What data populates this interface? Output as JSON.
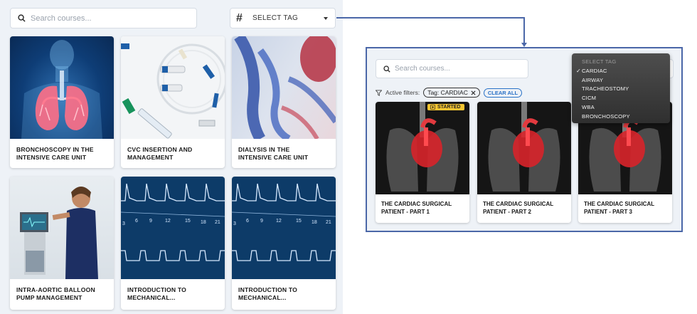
{
  "main": {
    "search": {
      "placeholder": "Search courses..."
    },
    "tag_select": {
      "label": "SELECT TAG"
    },
    "courses": [
      {
        "title_line1": "BRONCHOSCOPY IN THE",
        "title_line2": "INTENSIVE CARE UNIT"
      },
      {
        "title_line1": "CVC INSERTION AND",
        "title_line2": "MANAGEMENT"
      },
      {
        "title_line1": "DIALYSIS IN THE",
        "title_line2": "INTENSIVE CARE UNIT"
      },
      {
        "title_line1": "INTRA-AORTIC BALLOON",
        "title_line2": "PUMP MANAGEMENT"
      },
      {
        "title_line1": "INTRODUCTION TO",
        "title_line2": "MECHANICAL..."
      },
      {
        "title_line1": "INTRODUCTION TO",
        "title_line2": "MECHANICAL..."
      }
    ],
    "waveform_ticks": [
      "3",
      "6",
      "9",
      "12",
      "15",
      "18",
      "21"
    ]
  },
  "zoom": {
    "search": {
      "placeholder": "Search courses..."
    },
    "filters": {
      "label": "Active filters:",
      "tag_chip": "Tag: CARDIAC",
      "clear_all": "CLEAR ALL"
    },
    "courses": [
      {
        "title_line1": "THE CARDIAC SURGICAL",
        "title_line2": "PATIENT - PART 1",
        "badge": "STARTED"
      },
      {
        "title_line1": "THE CARDIAC SURGICAL",
        "title_line2": "PATIENT - PART 2"
      },
      {
        "title_line1": "THE CARDIAC SURGICAL",
        "title_line2": "PATIENT - PART 3"
      }
    ],
    "dropdown": {
      "header": "SELECT TAG",
      "options": [
        "CARDIAC",
        "AIRWAY",
        "TRACHEOSTOMY",
        "CICM",
        "WBA",
        "BRONCHOSCOPY"
      ],
      "selected": "CARDIAC"
    }
  },
  "colors": {
    "panel_bg": "#eef2f7",
    "connector": "#4b67a8",
    "badge": "#f5c531",
    "clear_all": "#2a72c7",
    "waveform_bg": "#0d3b68"
  },
  "icons": [
    "search-icon",
    "hash-icon",
    "caret-down-icon",
    "filter-icon",
    "close-icon",
    "play-icon",
    "check-icon"
  ]
}
